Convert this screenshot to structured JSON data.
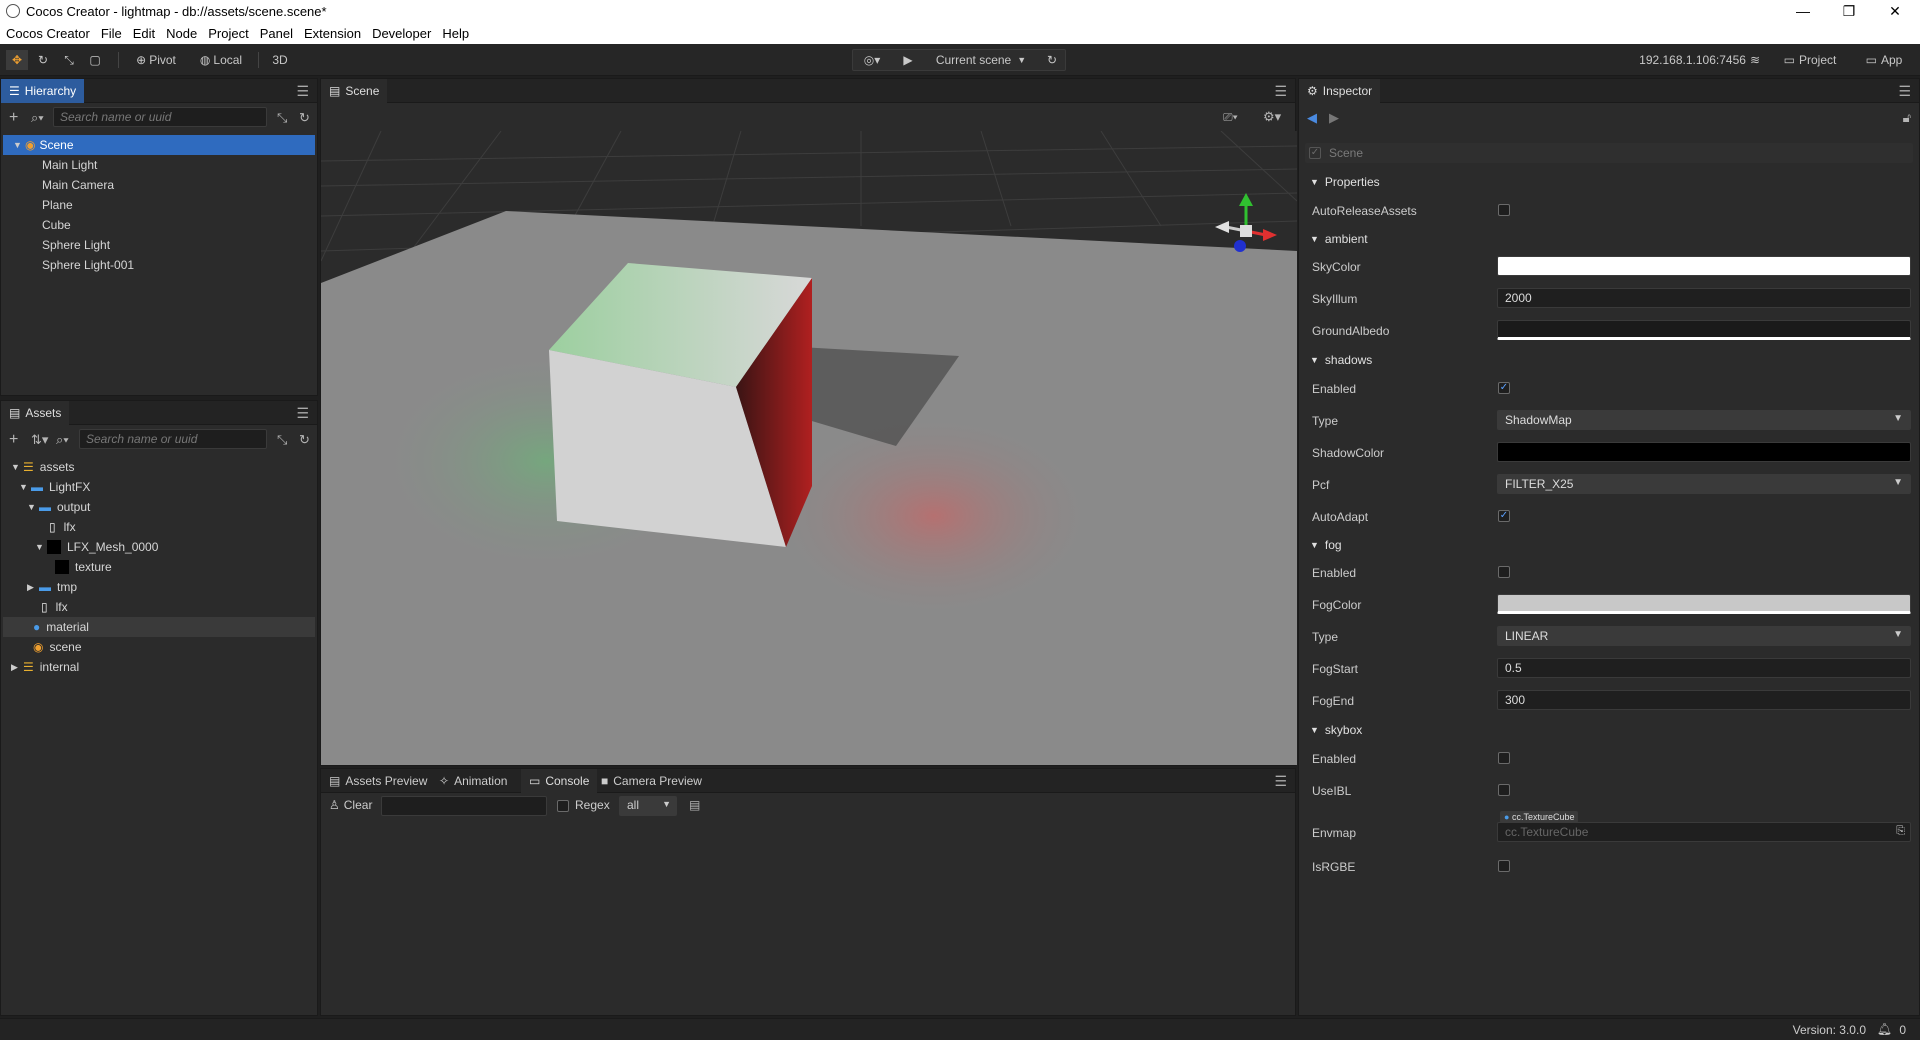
{
  "window": {
    "title": "Cocos Creator - lightmap - db://assets/scene.scene*",
    "controls": [
      "—",
      "❐",
      "✕"
    ]
  },
  "menu": [
    "Cocos Creator",
    "File",
    "Edit",
    "Node",
    "Project",
    "Panel",
    "Extension",
    "Developer",
    "Help"
  ],
  "toolbar": {
    "pivot": "Pivot",
    "local": "Local",
    "mode3d": "3D",
    "scene_select": "Current scene",
    "ip": "192.168.1.106:7456",
    "project_btn": "Project",
    "app_btn": "App"
  },
  "hierarchy": {
    "tab": "Hierarchy",
    "search_placeholder": "Search name or uuid",
    "nodes": [
      {
        "label": "Scene"
      },
      {
        "label": "Main Light"
      },
      {
        "label": "Main Camera"
      },
      {
        "label": "Plane"
      },
      {
        "label": "Cube"
      },
      {
        "label": "Sphere Light"
      },
      {
        "label": "Sphere Light-001"
      }
    ]
  },
  "assets": {
    "tab": "Assets",
    "search_placeholder": "Search name or uuid",
    "items": [
      {
        "label": "assets"
      },
      {
        "label": "LightFX"
      },
      {
        "label": "output"
      },
      {
        "label": "lfx"
      },
      {
        "label": "LFX_Mesh_0000"
      },
      {
        "label": "texture"
      },
      {
        "label": "tmp"
      },
      {
        "label": "lfx"
      },
      {
        "label": "material"
      },
      {
        "label": "scene"
      },
      {
        "label": "internal"
      }
    ]
  },
  "scene": {
    "tab": "Scene"
  },
  "bottom": {
    "tabs": [
      "Assets Preview",
      "Animation",
      "Console",
      "Camera Preview"
    ],
    "clear": "Clear",
    "regex": "Regex",
    "filter": "all"
  },
  "inspector": {
    "tab": "Inspector",
    "node_name": "Scene",
    "properties": "Properties",
    "auto_release": "AutoReleaseAssets",
    "ambient": {
      "section": "ambient",
      "sky_color_label": "SkyColor",
      "sky_color": "#ffffff",
      "sky_illum_label": "SkyIllum",
      "sky_illum": "2000",
      "ground_albedo_label": "GroundAlbedo",
      "ground_albedo": "#1a1a1a"
    },
    "shadows": {
      "section": "shadows",
      "enabled_label": "Enabled",
      "enabled": true,
      "type_label": "Type",
      "type": "ShadowMap",
      "shadow_color_label": "ShadowColor",
      "shadow_color": "#000000",
      "pcf_label": "Pcf",
      "pcf": "FILTER_X25",
      "auto_adapt_label": "AutoAdapt",
      "auto_adapt": true
    },
    "fog": {
      "section": "fog",
      "enabled_label": "Enabled",
      "enabled": false,
      "fog_color_label": "FogColor",
      "fog_color": "#c8c8c8",
      "type_label": "Type",
      "type": "LINEAR",
      "fog_start_label": "FogStart",
      "fog_start": "0.5",
      "fog_end_label": "FogEnd",
      "fog_end": "300"
    },
    "skybox": {
      "section": "skybox",
      "enabled_label": "Enabled",
      "enabled": false,
      "use_ibl_label": "UseIBL",
      "use_ibl": false,
      "envmap_label": "Envmap",
      "envmap_tag": "cc.TextureCube",
      "envmap_placeholder": "cc.TextureCube",
      "is_rgbe_label": "IsRGBE",
      "is_rgbe": false
    }
  },
  "status": {
    "version": "Version: 3.0.0",
    "notifications": "0"
  }
}
